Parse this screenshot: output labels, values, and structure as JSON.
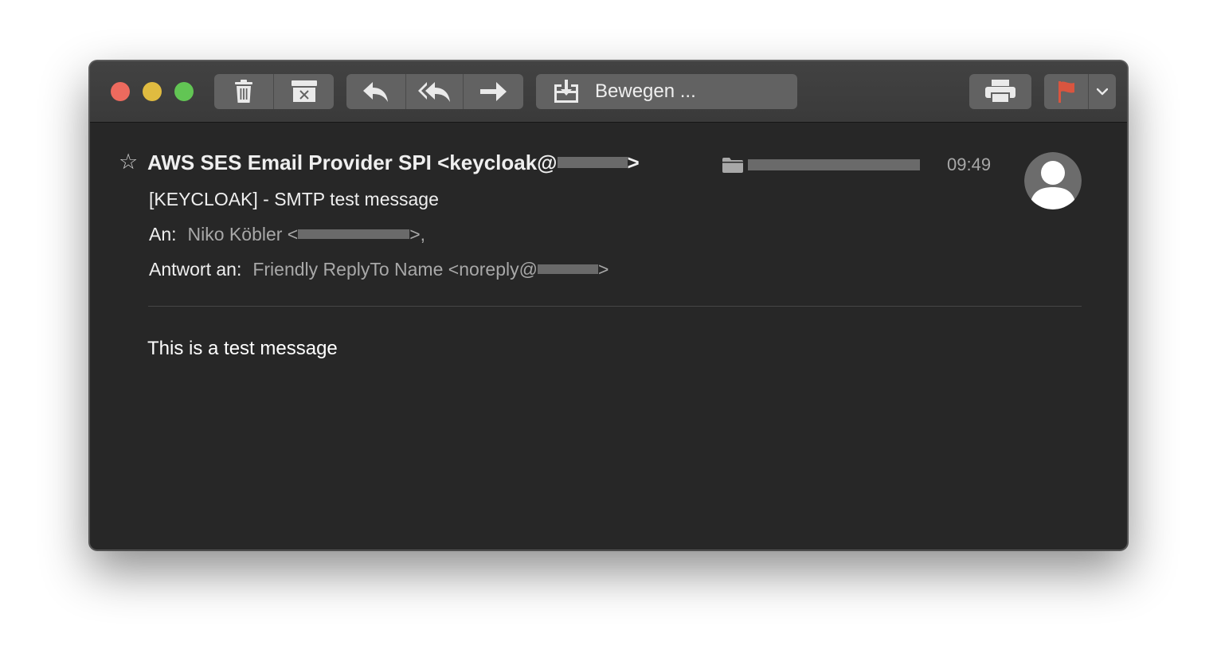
{
  "toolbar": {
    "move_label": "Bewegen ...",
    "icons": [
      "trash-icon",
      "archive-icon",
      "reply-icon",
      "reply-all-icon",
      "forward-icon",
      "move-icon",
      "print-icon",
      "flag-icon",
      "chevron-down-icon"
    ],
    "flag_color": "#d9553f"
  },
  "message": {
    "sender_text": "AWS SES Email Provider SPI <keycloak@",
    "sender_close": ">",
    "time": "09:49",
    "subject": "[KEYCLOAK] - SMTP test message",
    "to_label": "An:",
    "to_name": "Niko Köbler <",
    "to_close": ">,",
    "replyto_label": "Antwort an:",
    "replyto_value": "Friendly ReplyTo Name <noreply@",
    "replyto_close": ">",
    "body": "This is a test message"
  }
}
